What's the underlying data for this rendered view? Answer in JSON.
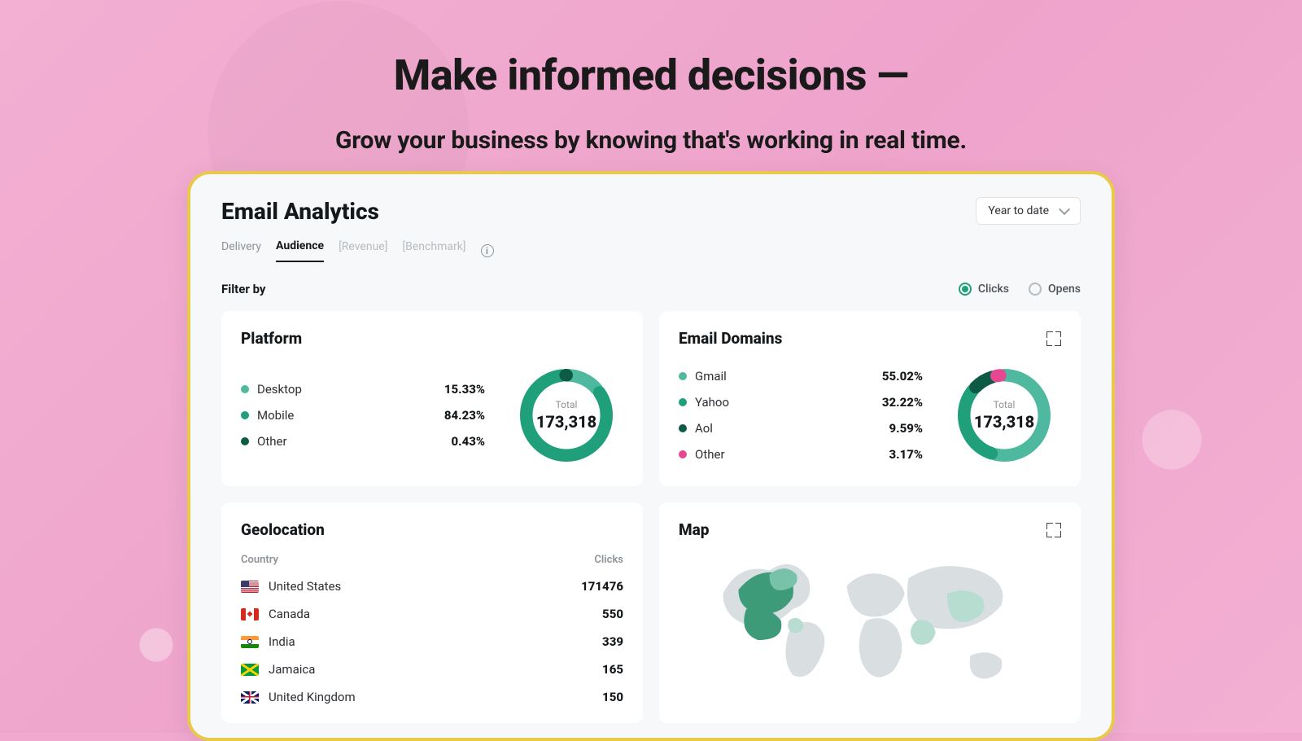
{
  "hero": {
    "title": "Make informed decisions —",
    "subtitle": "Grow your business by knowing that's working in real time."
  },
  "header": {
    "title": "Email Analytics",
    "range_label": "Year to date"
  },
  "tabs": {
    "items": [
      "Delivery",
      "Audience",
      "[Revenue]",
      "[Benchmark]"
    ],
    "active_index": 1
  },
  "filter": {
    "label": "Filter by",
    "options": [
      "Clicks",
      "Opens"
    ],
    "selected_index": 0
  },
  "platform": {
    "title": "Platform",
    "total_label": "Total",
    "total_value": "173,318",
    "rows": [
      {
        "label": "Desktop",
        "pct": "15.33%",
        "value": 15.33,
        "color": "#4fb9a0"
      },
      {
        "label": "Mobile",
        "pct": "84.23%",
        "value": 84.23,
        "color": "#1fa07a"
      },
      {
        "label": "Other",
        "pct": "0.43%",
        "value": 0.43,
        "color": "#0e5b45"
      }
    ]
  },
  "domains": {
    "title": "Email Domains",
    "total_label": "Total",
    "total_value": "173,318",
    "rows": [
      {
        "label": "Gmail",
        "pct": "55.02%",
        "value": 55.02,
        "color": "#4fb9a0"
      },
      {
        "label": "Yahoo",
        "pct": "32.22%",
        "value": 32.22,
        "color": "#1fa07a"
      },
      {
        "label": "Aol",
        "pct": "9.59%",
        "value": 9.59,
        "color": "#0e5b45"
      },
      {
        "label": "Other",
        "pct": "3.17%",
        "value": 3.17,
        "color": "#e54891"
      }
    ]
  },
  "geolocation": {
    "title": "Geolocation",
    "headers": {
      "country": "Country",
      "clicks": "Clicks"
    },
    "rows": [
      {
        "country": "United States",
        "clicks": "171476",
        "flag": "us"
      },
      {
        "country": "Canada",
        "clicks": "550",
        "flag": "ca"
      },
      {
        "country": "India",
        "clicks": "339",
        "flag": "in"
      },
      {
        "country": "Jamaica",
        "clicks": "165",
        "flag": "jm"
      },
      {
        "country": "United Kingdom",
        "clicks": "150",
        "flag": "uk"
      }
    ]
  },
  "map": {
    "title": "Map"
  },
  "chart_data": [
    {
      "type": "pie",
      "title": "Platform",
      "series": [
        {
          "name": "Desktop",
          "value": 15.33
        },
        {
          "name": "Mobile",
          "value": 84.23
        },
        {
          "name": "Other",
          "value": 0.43
        }
      ],
      "total": 173318
    },
    {
      "type": "pie",
      "title": "Email Domains",
      "series": [
        {
          "name": "Gmail",
          "value": 55.02
        },
        {
          "name": "Yahoo",
          "value": 32.22
        },
        {
          "name": "Aol",
          "value": 9.59
        },
        {
          "name": "Other",
          "value": 3.17
        }
      ],
      "total": 173318
    },
    {
      "type": "table",
      "title": "Geolocation",
      "columns": [
        "Country",
        "Clicks"
      ],
      "rows": [
        [
          "United States",
          171476
        ],
        [
          "Canada",
          550
        ],
        [
          "India",
          339
        ],
        [
          "Jamaica",
          165
        ],
        [
          "United Kingdom",
          150
        ]
      ]
    }
  ]
}
